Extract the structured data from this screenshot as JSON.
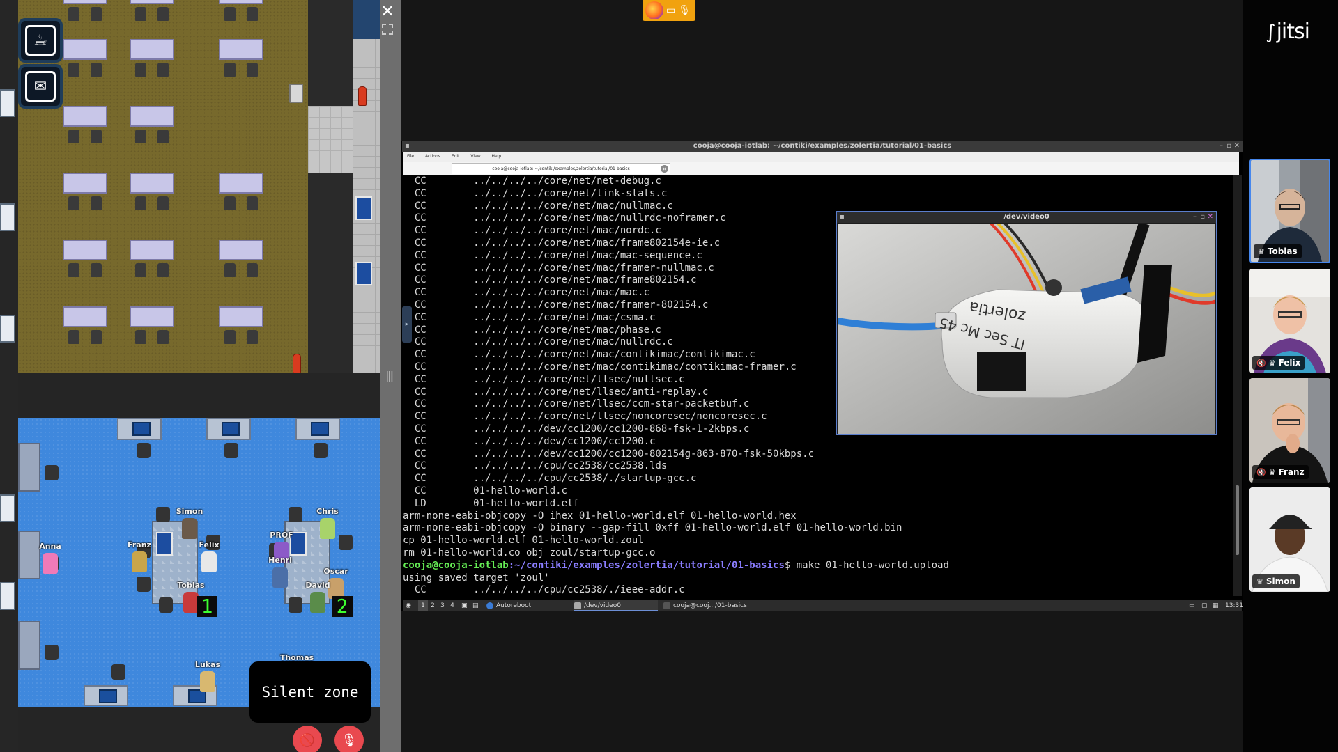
{
  "game": {
    "close_icon": "close-icon",
    "expand_icon": "fullscreen-icon",
    "buttons": [
      {
        "name": "coffee-button",
        "icon": "coffee-icon"
      },
      {
        "name": "mail-button",
        "icon": "envelope-icon"
      }
    ],
    "players": [
      {
        "name": "Simon",
        "color": "#6b5a4a"
      },
      {
        "name": "Franz",
        "color": "#c9a54a"
      },
      {
        "name": "Felix",
        "color": "#e8e8e8"
      },
      {
        "name": "Chris",
        "color": "#a8d36a"
      },
      {
        "name": "PROF",
        "color": "#8c5ac8"
      },
      {
        "name": "Anna",
        "color": "#f07ab8"
      },
      {
        "name": "Henri",
        "color": "#4b6fa8"
      },
      {
        "name": "Oscar",
        "color": "#c8a06a"
      },
      {
        "name": "David",
        "color": "#5a8c4a"
      },
      {
        "name": "Tobias",
        "color": "#c83a3a"
      },
      {
        "name": "Lukas",
        "color": "#d8b870"
      },
      {
        "name": "Thomas",
        "color": "#3fc45a"
      }
    ],
    "counters": [
      "1",
      "2"
    ],
    "silent_zone": "Silent zone",
    "camera_off_icon": "camera-off-icon",
    "mic_off_icon": "mic-off-icon"
  },
  "share": {
    "indicator_icons": [
      "firefox-icon",
      "camera-icon",
      "microphone-icon"
    ],
    "terminal": {
      "title": "cooja@cooja-iotlab: ~/contiki/examples/zolertia/tutorial/01-basics",
      "menu": [
        "File",
        "Actions",
        "Edit",
        "View",
        "Help"
      ],
      "tab_label": "cooja@cooja-iotlab: ~/contiki/examples/zolertia/tutorial/01-basics",
      "lines": [
        "  CC        ../../../../core/net/net-debug.c",
        "  CC        ../../../../core/net/link-stats.c",
        "  CC        ../../../../core/net/mac/nullmac.c",
        "  CC        ../../../../core/net/mac/nullrdc-noframer.c",
        "  CC        ../../../../core/net/mac/nordc.c",
        "  CC        ../../../../core/net/mac/frame802154e-ie.c",
        "  CC        ../../../../core/net/mac/mac-sequence.c",
        "  CC        ../../../../core/net/mac/framer-nullmac.c",
        "  CC        ../../../../core/net/mac/frame802154.c",
        "  CC        ../../../../core/net/mac/mac.c",
        "  CC        ../../../../core/net/mac/framer-802154.c",
        "  CC        ../../../../core/net/mac/csma.c",
        "  CC        ../../../../core/net/mac/phase.c",
        "  CC        ../../../../core/net/mac/nullrdc.c",
        "  CC        ../../../../core/net/mac/contikimac/contikimac.c",
        "  CC        ../../../../core/net/mac/contikimac/contikimac-framer.c",
        "  CC        ../../../../core/net/llsec/nullsec.c",
        "  CC        ../../../../core/net/llsec/anti-replay.c",
        "  CC        ../../../../core/net/llsec/ccm-star-packetbuf.c",
        "  CC        ../../../../core/net/llsec/noncoresec/noncoresec.c",
        "  CC        ../../../../dev/cc1200/cc1200-868-fsk-1-2kbps.c",
        "  CC        ../../../../dev/cc1200/cc1200.c",
        "  CC        ../../../../dev/cc1200/cc1200-802154g-863-870-fsk-50kbps.c",
        "  CC        ../../../../cpu/cc2538/cc2538.lds",
        "  CC        ../../../../cpu/cc2538/./startup-gcc.c",
        "  CC        01-hello-world.c",
        "  LD        01-hello-world.elf",
        "arm-none-eabi-objcopy -O ihex 01-hello-world.elf 01-hello-world.hex",
        "arm-none-eabi-objcopy -O binary --gap-fill 0xff 01-hello-world.elf 01-hello-world.bin",
        "cp 01-hello-world.elf 01-hello-world.zoul",
        "rm 01-hello-world.co obj_zoul/startup-gcc.o"
      ],
      "prompt_user": "cooja@cooja-iotlab",
      "prompt_path": ":~/contiki/examples/zolertia/tutorial/01-basics",
      "prompt_cmd": "$ make 01-hello-world.upload",
      "after_lines": [
        "using saved target 'zoul'",
        "  CC        ../../../../cpu/cc2538/./ieee-addr.c"
      ]
    },
    "video_window": {
      "title": "/dev/video0",
      "device_text": "zolertia",
      "handwritten": "IT Sec Mc 45"
    },
    "taskbar": {
      "workspaces": [
        "1",
        "2",
        "3",
        "4"
      ],
      "items": [
        "Autoreboot",
        "/dev/video0",
        "cooja@cooj.../01-basics"
      ],
      "clock": "13:31"
    }
  },
  "jitsi": {
    "logo": "jitsi",
    "participants": [
      {
        "name": "Tobias",
        "muted": false,
        "active": true
      },
      {
        "name": "Felix",
        "muted": true,
        "active": false
      },
      {
        "name": "Franz",
        "muted": true,
        "active": false
      },
      {
        "name": "Simon",
        "muted": false,
        "active": false
      }
    ]
  }
}
